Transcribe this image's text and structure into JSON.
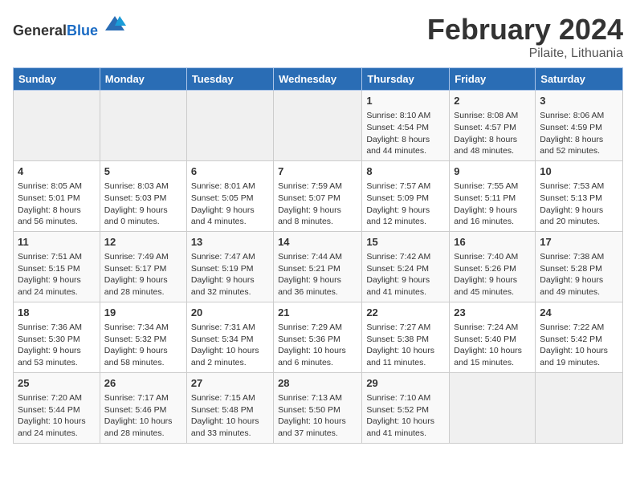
{
  "header": {
    "logo_general": "General",
    "logo_blue": "Blue",
    "month_title": "February 2024",
    "location": "Pilaite, Lithuania"
  },
  "weekdays": [
    "Sunday",
    "Monday",
    "Tuesday",
    "Wednesday",
    "Thursday",
    "Friday",
    "Saturday"
  ],
  "weeks": [
    [
      {
        "day": "",
        "info": ""
      },
      {
        "day": "",
        "info": ""
      },
      {
        "day": "",
        "info": ""
      },
      {
        "day": "",
        "info": ""
      },
      {
        "day": "1",
        "info": "Sunrise: 8:10 AM\nSunset: 4:54 PM\nDaylight: 8 hours\nand 44 minutes."
      },
      {
        "day": "2",
        "info": "Sunrise: 8:08 AM\nSunset: 4:57 PM\nDaylight: 8 hours\nand 48 minutes."
      },
      {
        "day": "3",
        "info": "Sunrise: 8:06 AM\nSunset: 4:59 PM\nDaylight: 8 hours\nand 52 minutes."
      }
    ],
    [
      {
        "day": "4",
        "info": "Sunrise: 8:05 AM\nSunset: 5:01 PM\nDaylight: 8 hours\nand 56 minutes."
      },
      {
        "day": "5",
        "info": "Sunrise: 8:03 AM\nSunset: 5:03 PM\nDaylight: 9 hours\nand 0 minutes."
      },
      {
        "day": "6",
        "info": "Sunrise: 8:01 AM\nSunset: 5:05 PM\nDaylight: 9 hours\nand 4 minutes."
      },
      {
        "day": "7",
        "info": "Sunrise: 7:59 AM\nSunset: 5:07 PM\nDaylight: 9 hours\nand 8 minutes."
      },
      {
        "day": "8",
        "info": "Sunrise: 7:57 AM\nSunset: 5:09 PM\nDaylight: 9 hours\nand 12 minutes."
      },
      {
        "day": "9",
        "info": "Sunrise: 7:55 AM\nSunset: 5:11 PM\nDaylight: 9 hours\nand 16 minutes."
      },
      {
        "day": "10",
        "info": "Sunrise: 7:53 AM\nSunset: 5:13 PM\nDaylight: 9 hours\nand 20 minutes."
      }
    ],
    [
      {
        "day": "11",
        "info": "Sunrise: 7:51 AM\nSunset: 5:15 PM\nDaylight: 9 hours\nand 24 minutes."
      },
      {
        "day": "12",
        "info": "Sunrise: 7:49 AM\nSunset: 5:17 PM\nDaylight: 9 hours\nand 28 minutes."
      },
      {
        "day": "13",
        "info": "Sunrise: 7:47 AM\nSunset: 5:19 PM\nDaylight: 9 hours\nand 32 minutes."
      },
      {
        "day": "14",
        "info": "Sunrise: 7:44 AM\nSunset: 5:21 PM\nDaylight: 9 hours\nand 36 minutes."
      },
      {
        "day": "15",
        "info": "Sunrise: 7:42 AM\nSunset: 5:24 PM\nDaylight: 9 hours\nand 41 minutes."
      },
      {
        "day": "16",
        "info": "Sunrise: 7:40 AM\nSunset: 5:26 PM\nDaylight: 9 hours\nand 45 minutes."
      },
      {
        "day": "17",
        "info": "Sunrise: 7:38 AM\nSunset: 5:28 PM\nDaylight: 9 hours\nand 49 minutes."
      }
    ],
    [
      {
        "day": "18",
        "info": "Sunrise: 7:36 AM\nSunset: 5:30 PM\nDaylight: 9 hours\nand 53 minutes."
      },
      {
        "day": "19",
        "info": "Sunrise: 7:34 AM\nSunset: 5:32 PM\nDaylight: 9 hours\nand 58 minutes."
      },
      {
        "day": "20",
        "info": "Sunrise: 7:31 AM\nSunset: 5:34 PM\nDaylight: 10 hours\nand 2 minutes."
      },
      {
        "day": "21",
        "info": "Sunrise: 7:29 AM\nSunset: 5:36 PM\nDaylight: 10 hours\nand 6 minutes."
      },
      {
        "day": "22",
        "info": "Sunrise: 7:27 AM\nSunset: 5:38 PM\nDaylight: 10 hours\nand 11 minutes."
      },
      {
        "day": "23",
        "info": "Sunrise: 7:24 AM\nSunset: 5:40 PM\nDaylight: 10 hours\nand 15 minutes."
      },
      {
        "day": "24",
        "info": "Sunrise: 7:22 AM\nSunset: 5:42 PM\nDaylight: 10 hours\nand 19 minutes."
      }
    ],
    [
      {
        "day": "25",
        "info": "Sunrise: 7:20 AM\nSunset: 5:44 PM\nDaylight: 10 hours\nand 24 minutes."
      },
      {
        "day": "26",
        "info": "Sunrise: 7:17 AM\nSunset: 5:46 PM\nDaylight: 10 hours\nand 28 minutes."
      },
      {
        "day": "27",
        "info": "Sunrise: 7:15 AM\nSunset: 5:48 PM\nDaylight: 10 hours\nand 33 minutes."
      },
      {
        "day": "28",
        "info": "Sunrise: 7:13 AM\nSunset: 5:50 PM\nDaylight: 10 hours\nand 37 minutes."
      },
      {
        "day": "29",
        "info": "Sunrise: 7:10 AM\nSunset: 5:52 PM\nDaylight: 10 hours\nand 41 minutes."
      },
      {
        "day": "",
        "info": ""
      },
      {
        "day": "",
        "info": ""
      }
    ]
  ]
}
